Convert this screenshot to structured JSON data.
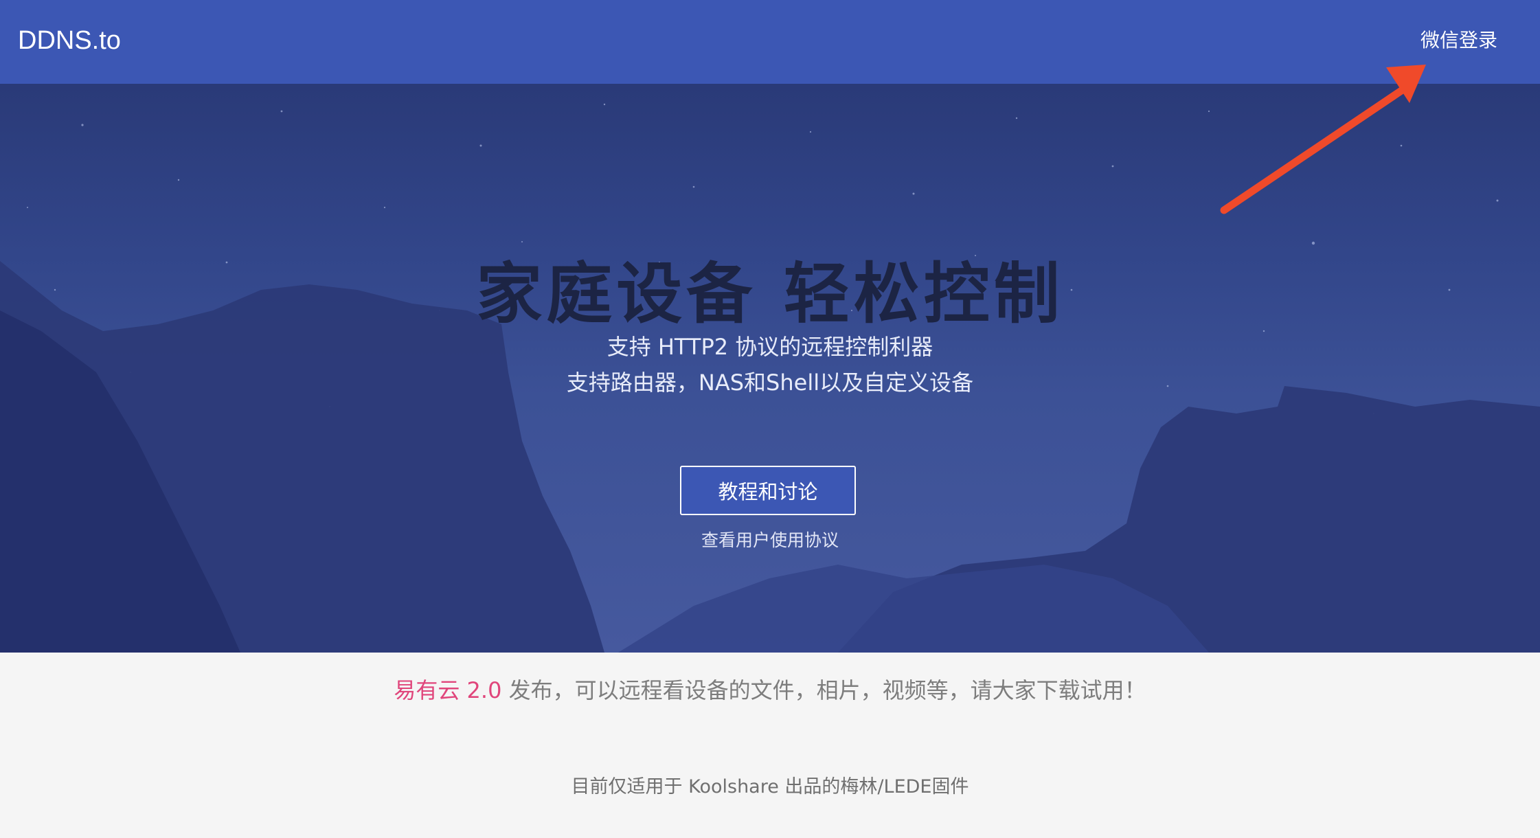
{
  "navbar": {
    "brand": "DDNS.to",
    "login_label": "微信登录"
  },
  "hero": {
    "title": "家庭设备 轻松控制",
    "subtitle_line1": "支持 HTTP2 协议的远程控制利器",
    "subtitle_line2": "支持路由器，NAS和Shell以及自定义设备",
    "cta_label": "教程和讨论",
    "terms_label": "查看用户使用协议"
  },
  "announcement": {
    "highlight": "易有云 2.0",
    "text": " 发布，可以远程看设备的文件，相片，视频等，请大家下载试用！"
  },
  "note": "目前仅适用于 Koolshare 出品的梅林/LEDE固件",
  "colors": {
    "navbar": "#3c57b4",
    "button": "#3c57b4",
    "highlight": "#e0457b",
    "annotation_arrow": "#f04a2a"
  }
}
